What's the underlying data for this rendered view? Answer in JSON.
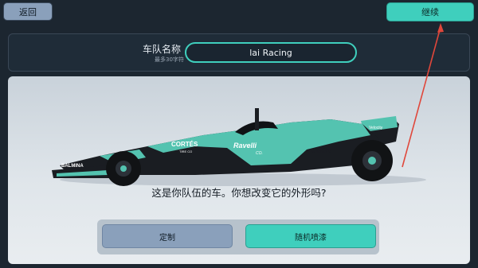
{
  "topbar": {
    "back_label": "返回",
    "continue_label": "继续"
  },
  "team_name": {
    "label": "车队名称",
    "hint": "最多30字符",
    "value": "lai Racing"
  },
  "car": {
    "livery_colors": {
      "primary": "#54c3b0",
      "secondary": "#1a1d22"
    },
    "sponsors": [
      "CORTÉS",
      "TIRE CO",
      "Ravelli",
      "CO.",
      "Chiffre",
      "BALMINA",
      "Velocity"
    ]
  },
  "prompt": {
    "text": "这是你队伍的车。你想改变它的外形吗?"
  },
  "actions": {
    "customize_label": "定制",
    "random_paint_label": "随机喷漆"
  },
  "colors": {
    "accent": "#3fcfbd",
    "secondary_button": "#8aa0bb",
    "background": "#1c2630",
    "arrow": "#e0473b"
  }
}
